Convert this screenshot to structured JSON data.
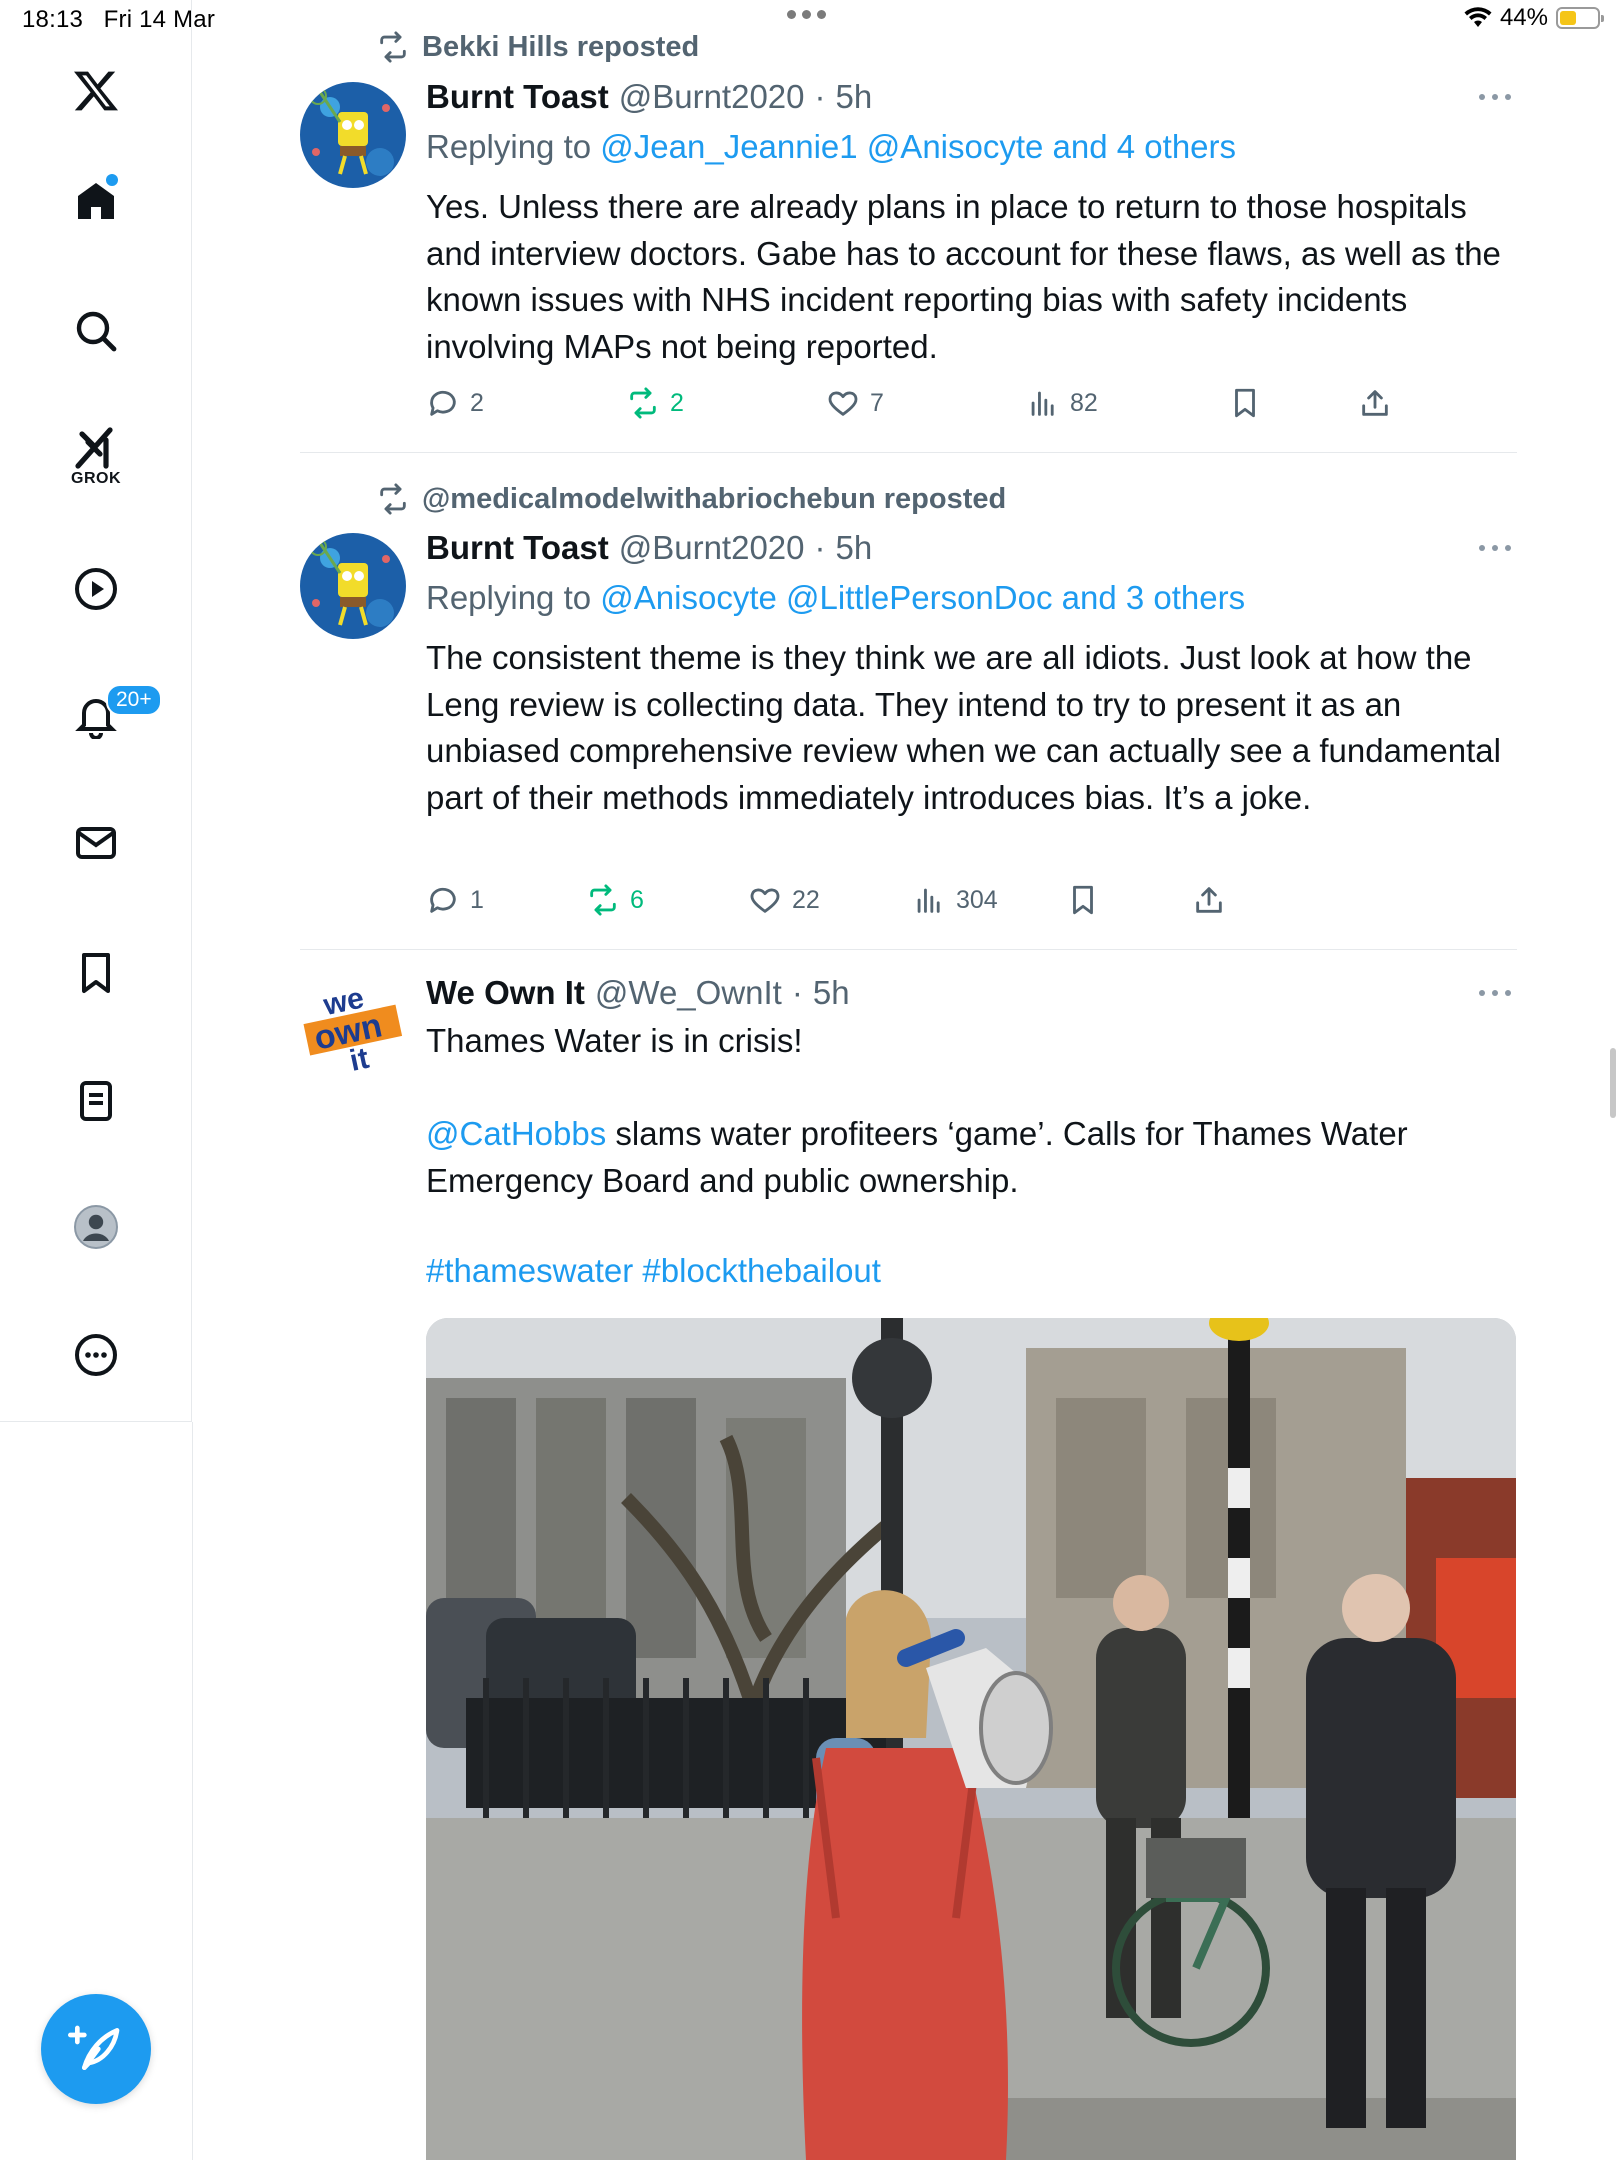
{
  "status_bar": {
    "time": "18:13",
    "date": "Fri 14 Mar",
    "battery": "44%",
    "battery_level": 0.44
  },
  "sidebar": {
    "grok_label": "GROK",
    "notifications_badge": "20+",
    "items": [
      "x-logo",
      "home",
      "search",
      "grok",
      "videos",
      "notifications",
      "messages",
      "bookmarks",
      "lists",
      "profile",
      "more"
    ]
  },
  "tweets": [
    {
      "repost_by": "Bekki Hills reposted",
      "name": "Burnt Toast",
      "handle": "@Burnt2020",
      "time": "5h",
      "reply_prefix": "Replying to",
      "reply_links": "@Jean_Jeannie1 @Anisocyte and 4 others",
      "body": "Yes. Unless there are already plans in place to return to those hospitals and interview doctors. Gabe has to account for these flaws, as well as the known issues with NHS incident reporting bias with safety incidents involving MAPs not being reported.",
      "replies": "2",
      "reposts": "2",
      "likes": "7",
      "views": "82"
    },
    {
      "repost_by": "@medicalmodelwithabriochebun reposted",
      "name": "Burnt Toast",
      "handle": "@Burnt2020",
      "time": "5h",
      "reply_prefix": "Replying to",
      "reply_links": "@Anisocyte @LittlePersonDoc and 3 others",
      "body": "The consistent theme is they think we are all idiots. Just look at how the Leng review is collecting data. They intend to try to present it as an unbiased comprehensive review when we can actually see a fundamental part of their methods immediately introduces bias. It’s a joke.",
      "replies": "1",
      "reposts": "6",
      "likes": "22",
      "views": "304"
    },
    {
      "name": "We Own It",
      "handle": "@We_OwnIt",
      "time": "5h",
      "avatar_text": [
        "we",
        "own",
        "it"
      ],
      "line1": "Thames Water is in crisis!",
      "mention": "@CatHobbs",
      "line2": " slams water profiteers ‘game’. Calls for Thames Water Emergency Board and public ownership.",
      "hashtags": "#thameswater #blockthebailout"
    }
  ],
  "colors": {
    "accent": "#1d9bf0",
    "repost_green": "#00ba7c",
    "secondary_text": "#536471"
  }
}
